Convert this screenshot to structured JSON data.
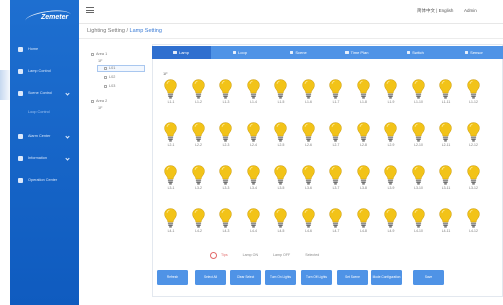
{
  "app": {
    "brand": "Zemeter",
    "header": {
      "language": "简体中文 | English",
      "user": "Admin"
    }
  },
  "sidebar": {
    "items": [
      {
        "label": "Home"
      },
      {
        "label": "Lamp Control"
      },
      {
        "label": "Scene Control"
      },
      {
        "label": "Loop Control"
      },
      {
        "label": "Alarm Center"
      },
      {
        "label": "Information"
      },
      {
        "label": "Operation Center"
      }
    ]
  },
  "breadcrumb": {
    "prefix": "Lighting Setting /",
    "current": "Lamp Setting"
  },
  "tree": {
    "root": "Area 1",
    "floor": "1F",
    "children": [
      "L01",
      "L02",
      "L03"
    ],
    "root2": "Area 2",
    "floor2": "1F"
  },
  "tabs": [
    {
      "label": "Lamp",
      "active": true
    },
    {
      "label": "Loop"
    },
    {
      "label": "Scene"
    },
    {
      "label": "Time Plan"
    },
    {
      "label": "Switch"
    },
    {
      "label": "Sensor"
    }
  ],
  "area_label": "1F",
  "lamps": [
    [
      "L1-1",
      "L1-2",
      "L1-3",
      "L1-4",
      "L1-5",
      "L1-6",
      "L1-7",
      "L1-8",
      "L1-9",
      "L1-10",
      "L1-11",
      "L1-12"
    ],
    [
      "L2-1",
      "L2-2",
      "L2-3",
      "L2-4",
      "L2-5",
      "L2-6",
      "L2-7",
      "L2-8",
      "L2-9",
      "L2-10",
      "L2-11",
      "L2-12"
    ],
    [
      "L3-1",
      "L3-2",
      "L3-3",
      "L3-4",
      "L3-5",
      "L3-6",
      "L3-7",
      "L3-8",
      "L3-9",
      "L3-10",
      "L3-11",
      "L3-12"
    ],
    [
      "L4-1",
      "L4-2",
      "L4-3",
      "L4-4",
      "L4-5",
      "L4-6",
      "L4-7",
      "L4-8",
      "L4-9",
      "L4-10",
      "L4-11",
      "L4-12"
    ]
  ],
  "lamp_color": "#f2c318",
  "legend": {
    "main": "Tips",
    "items": [
      "Lamp ON",
      "Lamp OFF",
      "Selected"
    ]
  },
  "buttons": [
    "Refresh",
    "Select All",
    "Clear Select",
    "Turn On Lights",
    "Turn Off Lights",
    "Set Scene",
    "Mode Configuration",
    "Save"
  ],
  "accent": "#4f93e6",
  "sidebar_color": "#1666c8"
}
